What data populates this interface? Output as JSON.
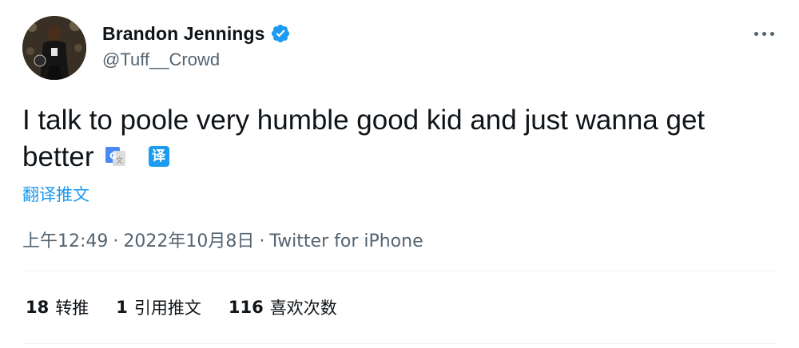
{
  "author": {
    "display_name": "Brandon Jennings",
    "handle": "@Tuff__Crowd",
    "verified": true
  },
  "tweet": {
    "text": "I talk to poole very humble good kid and just wanna get better",
    "translate_label": "翻译推文",
    "translate_glyph": "译"
  },
  "meta": {
    "time": "上午12:49",
    "separator": "·",
    "date": "2022年10月8日",
    "source": "Twitter for iPhone"
  },
  "stats": {
    "retweets_count": "18",
    "retweets_label": "转推",
    "quotes_count": "1",
    "quotes_label": "引用推文",
    "likes_count": "116",
    "likes_label": "喜欢次数"
  },
  "colors": {
    "accent": "#1d9bf0",
    "text_primary": "#0f1419",
    "text_secondary": "#536471",
    "divider": "#eff3f4"
  }
}
